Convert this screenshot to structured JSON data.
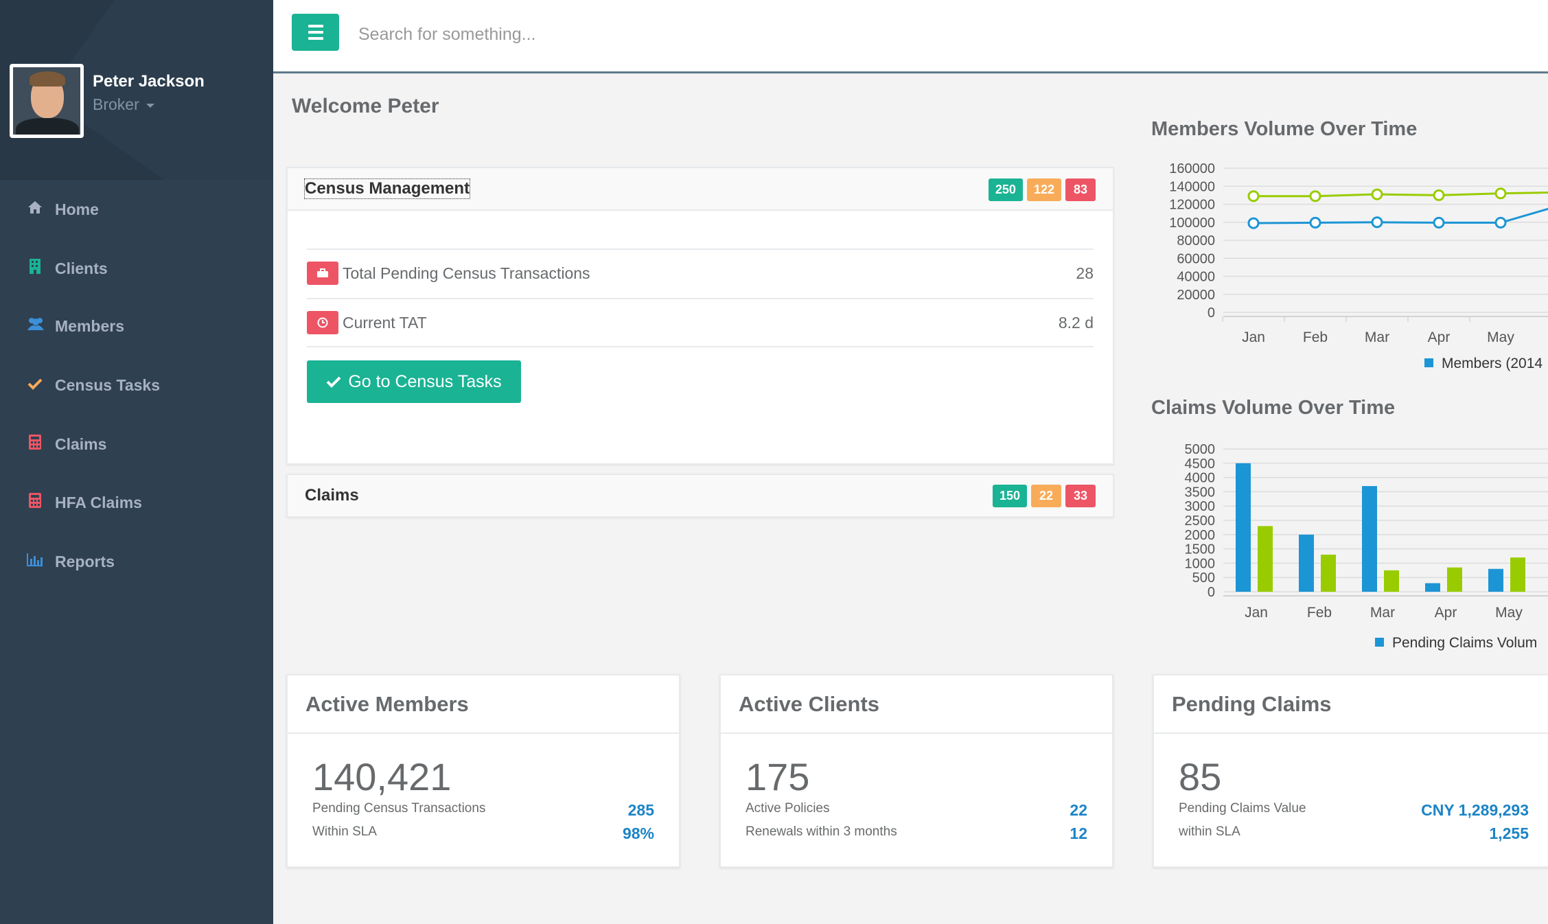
{
  "topbar": {
    "search_placeholder": "Search for something..."
  },
  "profile": {
    "name": "Peter Jackson",
    "role": "Broker"
  },
  "sidebar": {
    "items": [
      {
        "label": "Home",
        "icon": "home-icon"
      },
      {
        "label": "Clients",
        "icon": "clients-icon"
      },
      {
        "label": "Members",
        "icon": "members-icon"
      },
      {
        "label": "Census Tasks",
        "icon": "check-icon"
      },
      {
        "label": "Claims",
        "icon": "calculator-icon"
      },
      {
        "label": "HFA Claims",
        "icon": "calculator-icon"
      },
      {
        "label": "Reports",
        "icon": "bar-chart-icon"
      }
    ]
  },
  "welcome": "Welcome Peter",
  "census": {
    "title": "Census Management",
    "badges": [
      "250",
      "122",
      "83"
    ],
    "rows": [
      {
        "label": "Total Pending Census Transactions",
        "value": "28"
      },
      {
        "label": "Current TAT",
        "value": "8.2 d"
      }
    ],
    "button": "Go to Census Tasks"
  },
  "claims_panel": {
    "title": "Claims",
    "badges": [
      "150",
      "22",
      "33"
    ]
  },
  "stats": [
    {
      "title": "Active Members",
      "big": "140,421",
      "lines": [
        {
          "label": "Pending Census Transactions",
          "value": "285"
        },
        {
          "label": "Within SLA",
          "value": "98%"
        }
      ]
    },
    {
      "title": "Active Clients",
      "big": "175",
      "lines": [
        {
          "label": "Active Policies",
          "value": "22"
        },
        {
          "label": "Renewals within 3 months",
          "value": "12"
        }
      ]
    },
    {
      "title": "Pending Claims",
      "big": "85",
      "lines": [
        {
          "label": "Pending Claims Value",
          "value": "CNY 1,289,293"
        },
        {
          "label": "within SLA",
          "value": "1,255"
        }
      ]
    }
  ],
  "colors": {
    "accent": "#1ab394",
    "orange": "#f8ac59",
    "red": "#ed5565",
    "blue": "#1c84c6",
    "sidebar": "#2f4050"
  },
  "chart_data": [
    {
      "type": "line",
      "title": "Members Volume Over Time",
      "categories": [
        "Jan",
        "Feb",
        "Mar",
        "Apr",
        "May"
      ],
      "yticks": [
        0,
        20000,
        40000,
        60000,
        80000,
        100000,
        120000,
        140000,
        160000
      ],
      "ylim": [
        0,
        160000
      ],
      "series": [
        {
          "name": "",
          "color": "#99cc00",
          "values": [
            129000,
            129000,
            131000,
            130000,
            132000
          ]
        },
        {
          "name": "",
          "color": "#1c95d4",
          "values": [
            99000,
            99500,
            100000,
            99500,
            99500
          ]
        }
      ],
      "legend": "Members (2014"
    },
    {
      "type": "bar",
      "title": "Claims Volume Over Time",
      "categories": [
        "Jan",
        "Feb",
        "Mar",
        "Apr",
        "May"
      ],
      "yticks": [
        0,
        500,
        1000,
        1500,
        2000,
        2500,
        3000,
        3500,
        4000,
        4500,
        5000
      ],
      "ylim": [
        0,
        5000
      ],
      "series": [
        {
          "name": "",
          "color": "#1c95d4",
          "values": [
            4500,
            2000,
            3700,
            300,
            800
          ]
        },
        {
          "name": "",
          "color": "#99cc00",
          "values": [
            2300,
            1300,
            750,
            850,
            1200
          ]
        }
      ],
      "legend": "Pending Claims Volum"
    }
  ]
}
